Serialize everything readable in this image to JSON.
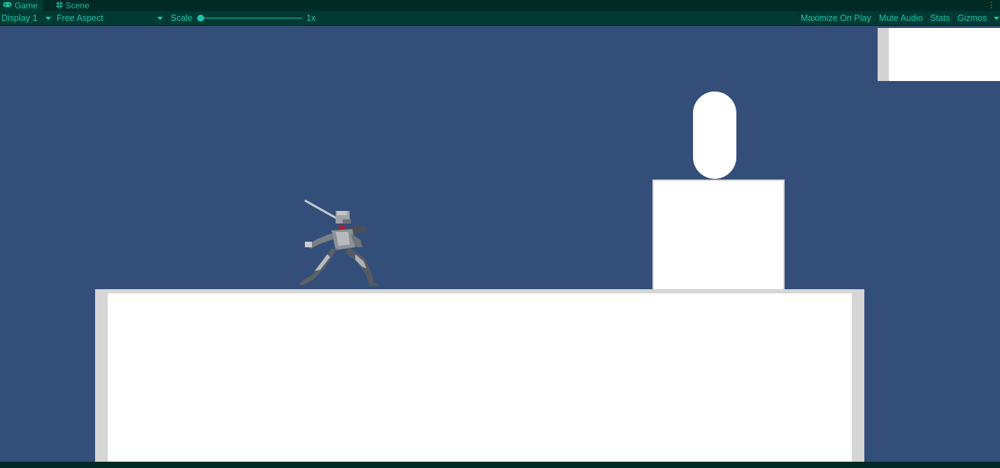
{
  "tabs": [
    {
      "label": "Game",
      "icon": "gamepad-icon",
      "glyph": "🎮"
    },
    {
      "label": "Scene",
      "icon": "grid-icon",
      "glyph": "#"
    }
  ],
  "toolbar": {
    "display_label": "Display 1",
    "aspect_label": "Free Aspect",
    "scale_label": "Scale",
    "scale_value": "1x",
    "maximize_label": "Maximize On Play",
    "mute_label": "Mute Audio",
    "stats_label": "Stats",
    "gizmos_label": "Gizmos"
  },
  "colors": {
    "accent": "#1fc3a6",
    "viewport_bg": "#334e79",
    "panel_bg": "#003b33",
    "block": "#ffffff",
    "block_shade": "#d6d6d6"
  }
}
